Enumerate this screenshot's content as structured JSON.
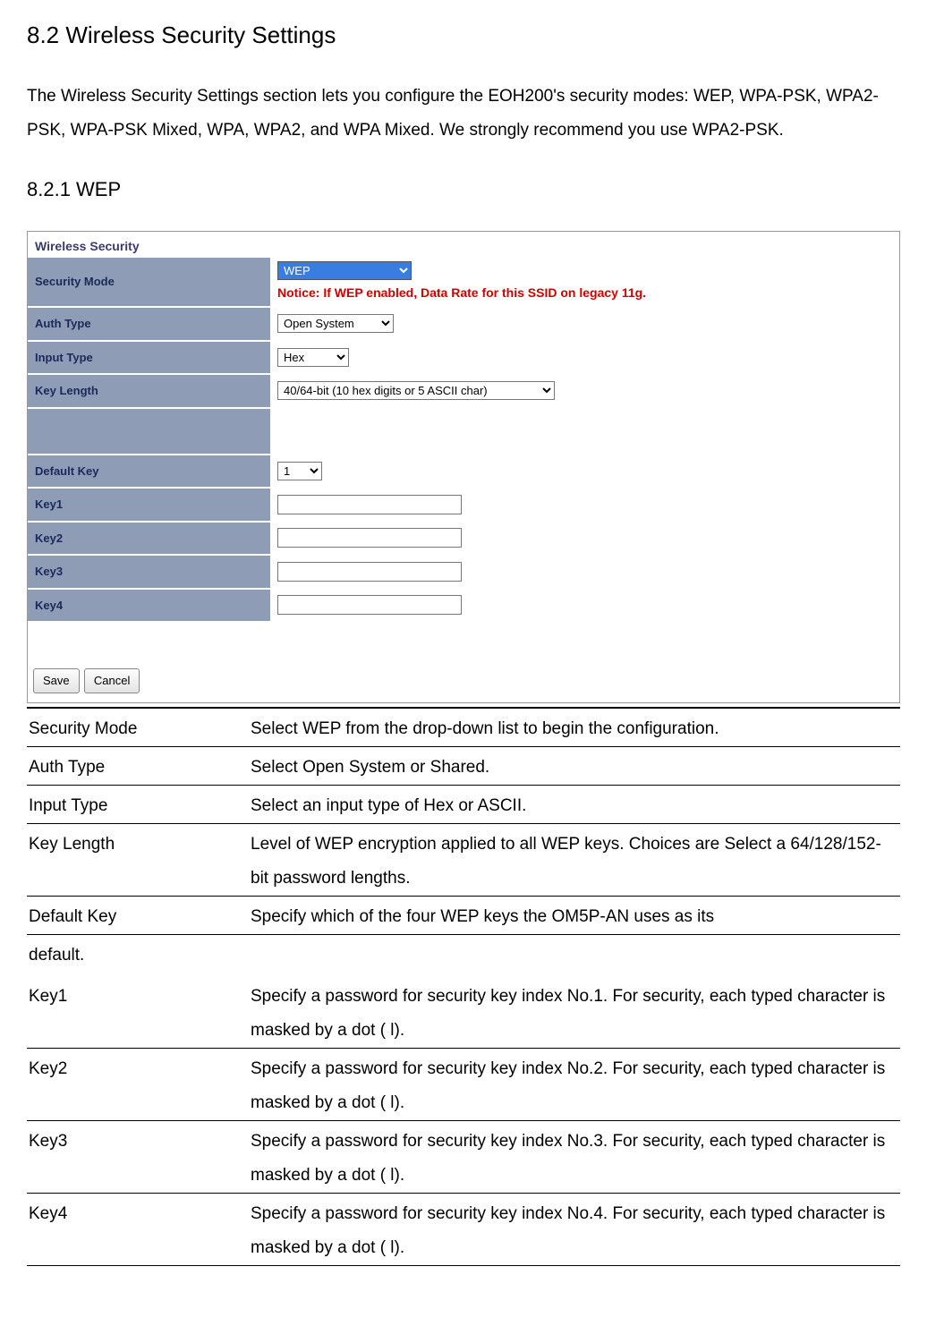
{
  "section": {
    "title": "8.2 Wireless Security Settings",
    "intro": "The Wireless Security Settings section lets you configure the EOH200's security modes: WEP, WPA-PSK, WPA2-PSK, WPA-PSK Mixed, WPA, WPA2, and WPA Mixed. We strongly recommend you use WPA2-PSK.",
    "sub_title": "8.2.1 WEP"
  },
  "panel": {
    "header": "Wireless Security",
    "rows": {
      "security_mode": {
        "label": "Security Mode",
        "value": "WEP",
        "notice": "Notice: If WEP enabled, Data Rate for this SSID on legacy 11g."
      },
      "auth_type": {
        "label": "Auth Type",
        "value": "Open System"
      },
      "input_type": {
        "label": "Input Type",
        "value": "Hex"
      },
      "key_length": {
        "label": "Key Length",
        "value": "40/64-bit (10 hex digits or 5 ASCII char)"
      },
      "default_key": {
        "label": "Default Key",
        "value": "1"
      },
      "key1": {
        "label": "Key1",
        "value": ""
      },
      "key2": {
        "label": "Key2",
        "value": ""
      },
      "key3": {
        "label": "Key3",
        "value": ""
      },
      "key4": {
        "label": "Key4",
        "value": ""
      }
    },
    "buttons": {
      "save": "Save",
      "cancel": "Cancel"
    }
  },
  "desc": {
    "security_mode": {
      "term": "Security Mode",
      "text": "Select WEP from the drop-down  list to begin the configuration."
    },
    "auth_type": {
      "term": "Auth Type",
      "text": "Select Open System or Shared."
    },
    "input_type": {
      "term": "Input Type",
      "text": "Select an input type of Hex or ASCII."
    },
    "key_length": {
      "term": "Key Length",
      "text": "Level of WEP encryption applied to all WEP keys. Choices are Select a 64/128/152-bit password lengths."
    },
    "default_key": {
      "term": "Default Key",
      "text": "Specify which of the four WEP keys the OM5P-AN uses as its"
    },
    "default_key_cont": "default.",
    "key1": {
      "term": "Key1",
      "text": "Specify a password for security key index No.1. For security, each typed character is masked by a dot (   l)."
    },
    "key2": {
      "term": "Key2",
      "text": "Specify a password for security key index No.2. For security, each typed character is masked by a dot (   l)."
    },
    "key3": {
      "term": "Key3",
      "text": "Specify a password for security key index No.3. For security, each typed character is masked by a dot (   l)."
    },
    "key4": {
      "term": "Key4",
      "text": "Specify a password for security key index No.4. For security, each typed character is masked by a dot (   l)."
    }
  }
}
